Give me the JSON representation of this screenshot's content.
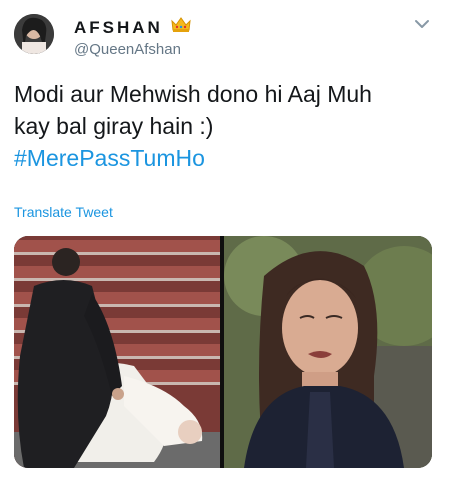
{
  "author": {
    "display_name": "AFSHAN",
    "handle": "@QueenAfshan",
    "avatar_icon": "profile-photo",
    "badge_icon": "crown-emoji-icon"
  },
  "tweet": {
    "line1": "Modi aur Mehwish dono hi Aaj Muh",
    "line2": "kay bal giray hain :)",
    "hashtag": "#MerePassTumHo",
    "translate_label": "Translate Tweet"
  },
  "menu": {
    "icon": "chevron-down-icon"
  },
  "media": {
    "left_image": "photo-man-falling-on-stairs",
    "right_image": "photo-woman-crying"
  },
  "colors": {
    "link": "#1b95e0",
    "text": "#14171a",
    "muted": "#657786"
  }
}
